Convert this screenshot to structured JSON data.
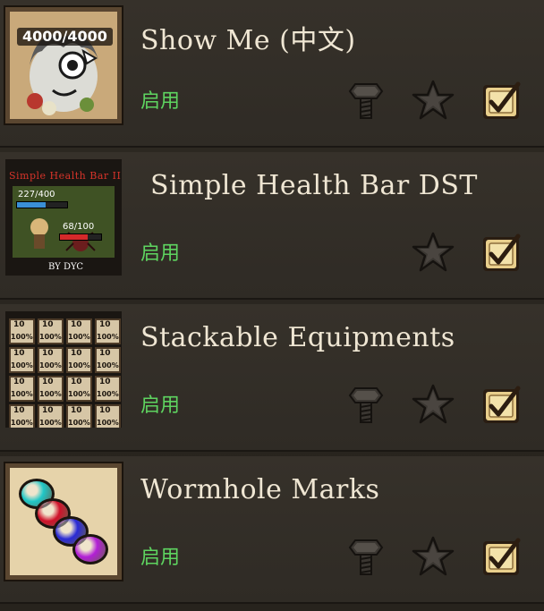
{
  "mods": [
    {
      "title": "Show Me (中文)",
      "status": "启用",
      "thumb": {
        "kind": "show-me",
        "hp_readout": "4000/4000"
      },
      "has_config": true,
      "favorite": false,
      "enabled": true
    },
    {
      "title": "Simple Health Bar DST",
      "status": "启用",
      "thumb": {
        "kind": "simple-health-bar",
        "banner": "Simple Health Bar II",
        "player_hp": "227/400",
        "enemy_hp": "68/100",
        "author": "BY DYC"
      },
      "has_config": false,
      "favorite": false,
      "enabled": true
    },
    {
      "title": "Stackable Equipments",
      "status": "启用",
      "thumb": {
        "kind": "stackable",
        "count": "10",
        "percent": "100%"
      },
      "has_config": true,
      "favorite": false,
      "enabled": true
    },
    {
      "title": "Wormhole Marks",
      "status": "启用",
      "thumb": {
        "kind": "wormhole",
        "gem_colors": [
          "#1fc7c7",
          "#d0122a",
          "#2a2ad6",
          "#b21fd6"
        ]
      },
      "has_config": true,
      "favorite": false,
      "enabled": true
    }
  ],
  "colors": {
    "title": "#efe6d3",
    "status": "#5ed460",
    "icon_dark": "#3a3631",
    "checkbox_bg": "#e9cf8c",
    "check_mark": "#2c1d10"
  }
}
